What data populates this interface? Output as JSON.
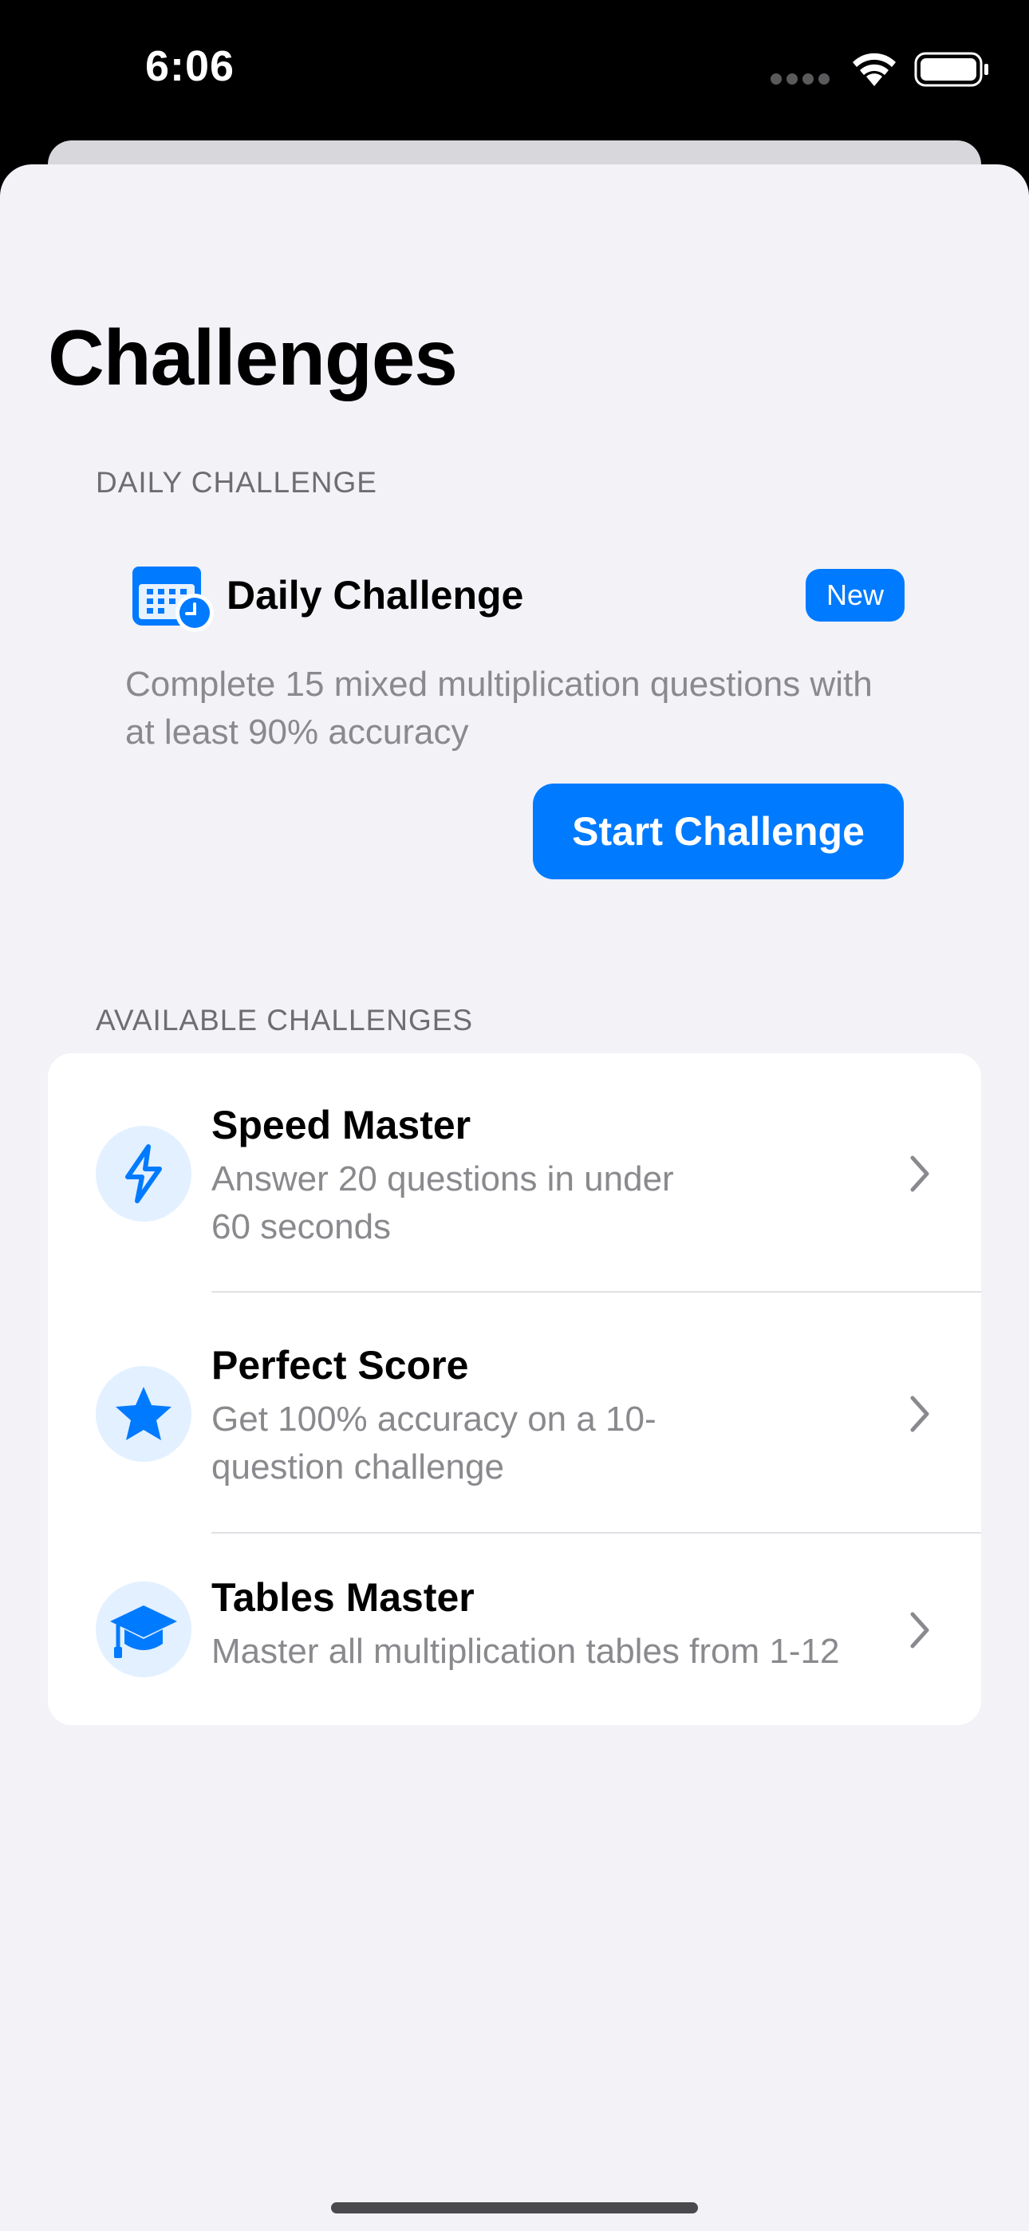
{
  "status_bar": {
    "time": "6:06"
  },
  "page": {
    "title": "Challenges"
  },
  "daily_section": {
    "header": "DAILY CHALLENGE",
    "title": "Daily Challenge",
    "badge": "New",
    "description": "Complete 15 mixed multiplication questions with at least 90% accuracy",
    "button_label": "Start Challenge",
    "icon": "calendar-clock-icon"
  },
  "available_section": {
    "header": "AVAILABLE CHALLENGES",
    "items": [
      {
        "title": "Speed Master",
        "description": "Answer 20 questions in under 60 seconds",
        "icon": "bolt-icon"
      },
      {
        "title": "Perfect Score",
        "description": "Get 100% accuracy on a 10-question challenge",
        "icon": "star-icon"
      },
      {
        "title": "Tables Master",
        "description": "Master all multiplication tables from 1-12",
        "icon": "graduation-cap-icon"
      }
    ]
  },
  "colors": {
    "accent": "#007aff",
    "background": "#f2f2f7",
    "card": "#ffffff",
    "secondary_text": "#8a8a8e",
    "icon_circle": "#e3f0ff"
  }
}
